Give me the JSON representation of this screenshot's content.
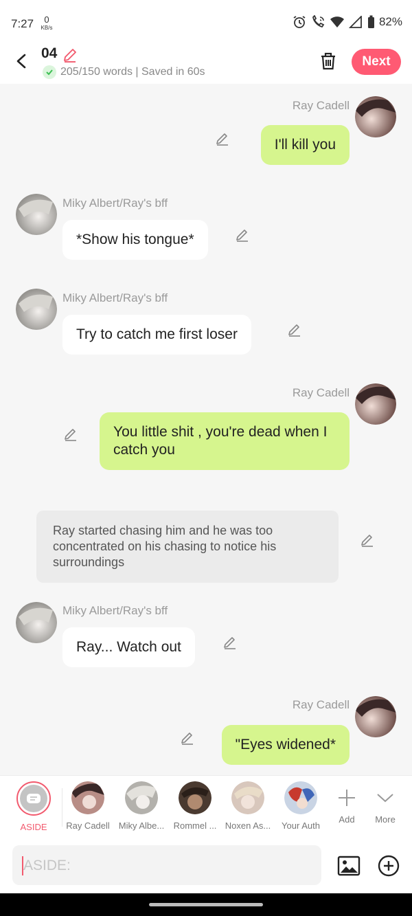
{
  "status_bar": {
    "time": "7:27",
    "net_speed": "0",
    "net_unit": "KB/s",
    "battery": "82%"
  },
  "header": {
    "title": "04",
    "word_status": "205/150 words | Saved in 60s",
    "next_label": "Next"
  },
  "messages": [
    {
      "type": "me",
      "name": "Ray Cadell",
      "text": "I'll kill you"
    },
    {
      "type": "other",
      "name": "Miky Albert/Ray's bff",
      "text": "*Show his tongue*"
    },
    {
      "type": "other",
      "name": "Miky Albert/Ray's bff",
      "text": "Try to catch me first loser"
    },
    {
      "type": "me",
      "name": "Ray Cadell",
      "text": "You little shit , you're dead when I catch you"
    },
    {
      "type": "aside",
      "text": "Ray started chasing him and he was too concentrated on his chasing to notice his surroundings"
    },
    {
      "type": "other",
      "name": "Miky Albert/Ray's bff",
      "text": "Ray... Watch out"
    },
    {
      "type": "me",
      "name": "Ray Cadell",
      "text": "\"Eyes widened*"
    }
  ],
  "characters": [
    {
      "label": "ASIDE",
      "selected": true
    },
    {
      "label": "Ray Cadell"
    },
    {
      "label": "Miky Albe..."
    },
    {
      "label": "Rommel ..."
    },
    {
      "label": "Noxen As..."
    },
    {
      "label": "Your Auth"
    },
    {
      "label": "Add"
    },
    {
      "label": "More"
    }
  ],
  "input": {
    "placeholder": "ASIDE:"
  },
  "colors": {
    "accent": "#ff5a73",
    "my_bubble": "#d6f58e",
    "other_bubble": "#ffffff",
    "aside_box": "#ebebeb",
    "background": "#f6f6f6"
  },
  "icons": {
    "back": "back-arrow-icon",
    "edit": "pencil-icon",
    "trash": "trash-icon",
    "check": "check-icon",
    "image": "image-icon",
    "plus": "plus-circle-icon",
    "add": "plus-icon",
    "more": "chevron-down-icon"
  }
}
